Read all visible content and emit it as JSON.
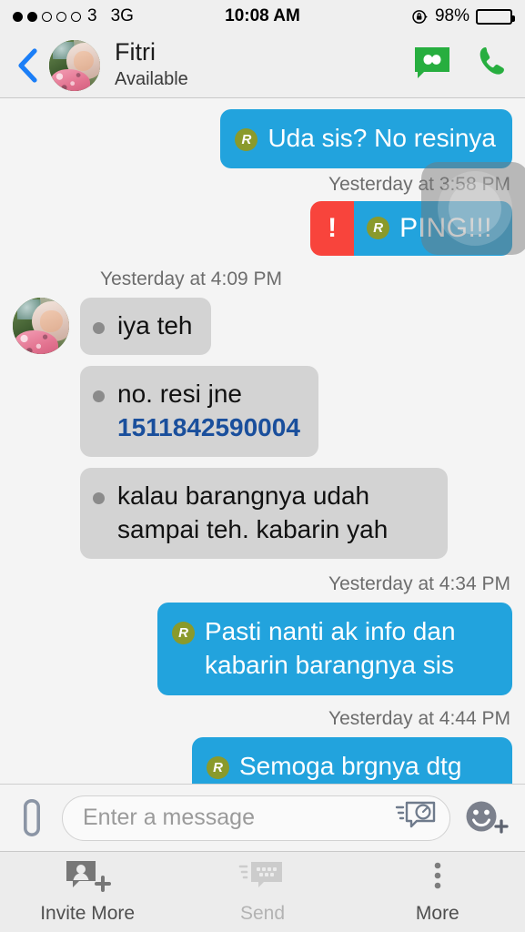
{
  "status_bar": {
    "signal_dots_total": 5,
    "signal_dots_filled": 2,
    "carrier": "3",
    "network": "3G",
    "time": "10:08 AM",
    "battery_percent": "98%",
    "lock_icon": "rotation-lock-icon"
  },
  "header": {
    "back_icon": "back-chevron-icon",
    "contact_name": "Fitri",
    "contact_status": "Available",
    "video_icon": "bbm-video-chat-icon",
    "call_icon": "phone-call-icon",
    "avatar": "contact-avatar"
  },
  "conversation": [
    {
      "id": "m1",
      "direction": "out",
      "text": "Uda sis? No resinya",
      "badge": "R",
      "timestamp": "Yesterday at 3:58 PM",
      "timestamp_position": "below"
    },
    {
      "id": "m2",
      "direction": "out",
      "type": "ping",
      "alert_glyph": "!",
      "text": "PING!!!",
      "badge": "R"
    },
    {
      "id": "m3",
      "direction": "in",
      "timestamp": "Yesterday at 4:09 PM",
      "text": "iya teh",
      "show_avatar": true
    },
    {
      "id": "m4",
      "direction": "in",
      "text": "no. resi jne ",
      "link_text": "1511842590004",
      "show_avatar": false
    },
    {
      "id": "m5",
      "direction": "in",
      "text": "kalau barangnya udah sampai teh. kabarin yah",
      "show_avatar": false
    },
    {
      "id": "m6",
      "direction": "out",
      "timestamp": "Yesterday at 4:34 PM",
      "text": "Pasti nanti ak info dan kabarin barangnya sis",
      "badge": "R"
    },
    {
      "id": "m7",
      "direction": "out",
      "timestamp": "Yesterday at 4:44 PM",
      "text": "Semoga brgnya dtg tepat waktu yaa",
      "badge": "R"
    }
  ],
  "input_bar": {
    "attach_icon": "paperclip-icon",
    "placeholder": "Enter a message",
    "value": "",
    "timed_message_icon": "timed-message-icon",
    "emoji_icon": "emoji-add-icon"
  },
  "toolbar": {
    "items": [
      {
        "label": "Invite More",
        "icon": "invite-contact-icon",
        "enabled": true
      },
      {
        "label": "Send",
        "icon": "bbm-send-icon",
        "enabled": false
      },
      {
        "label": "More",
        "icon": "more-vertical-icon",
        "enabled": true
      }
    ]
  },
  "colors": {
    "outgoing_bubble": "#22a3dd",
    "incoming_bubble": "#d3d3d3",
    "ping_alert": "#f8443c",
    "read_badge": "#8a9a2b",
    "accent_green": "#27ae3f",
    "link_blue": "#1a4f9c",
    "chrome": "#efefef"
  }
}
